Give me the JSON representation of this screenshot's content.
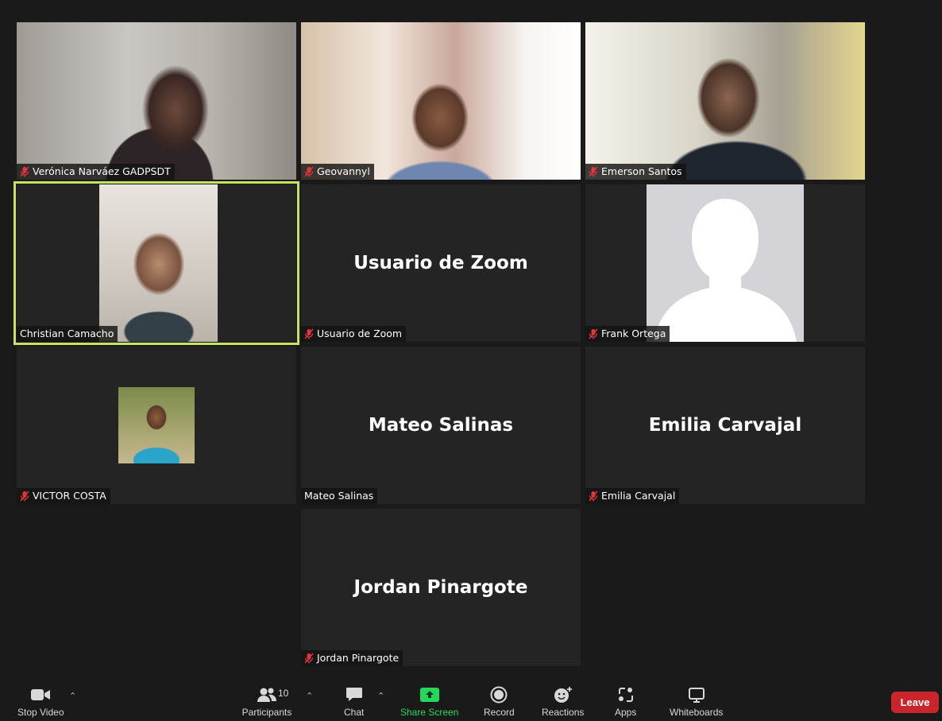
{
  "participants": [
    {
      "name": "Verónica Narváez GADPSDT",
      "muted": true
    },
    {
      "name": "Geovannyl",
      "muted": true
    },
    {
      "name": "Emerson Santos",
      "muted": true
    },
    {
      "name": "Christian Camacho",
      "muted": false
    },
    {
      "name": "Usuario de Zoom",
      "muted": true
    },
    {
      "name": "Frank Ortega",
      "muted": true
    },
    {
      "name": "VICTOR COSTA",
      "muted": true
    },
    {
      "name": "Mateo Salinas",
      "muted": false
    },
    {
      "name": "Emilia Carvajal",
      "muted": true
    },
    {
      "name": "Jordan Pinargote",
      "muted": true
    }
  ],
  "toolbar": {
    "stop_video": "Stop Video",
    "participants": "Participants",
    "participants_count": "10",
    "chat": "Chat",
    "share_screen": "Share Screen",
    "record": "Record",
    "reactions": "Reactions",
    "apps": "Apps",
    "whiteboards": "Whiteboards",
    "leave": "Leave"
  },
  "colors": {
    "active_speaker": "#c6e35e",
    "share_green": "#23d959",
    "leave_red": "#c8252c",
    "muted_red": "#e0353b"
  }
}
